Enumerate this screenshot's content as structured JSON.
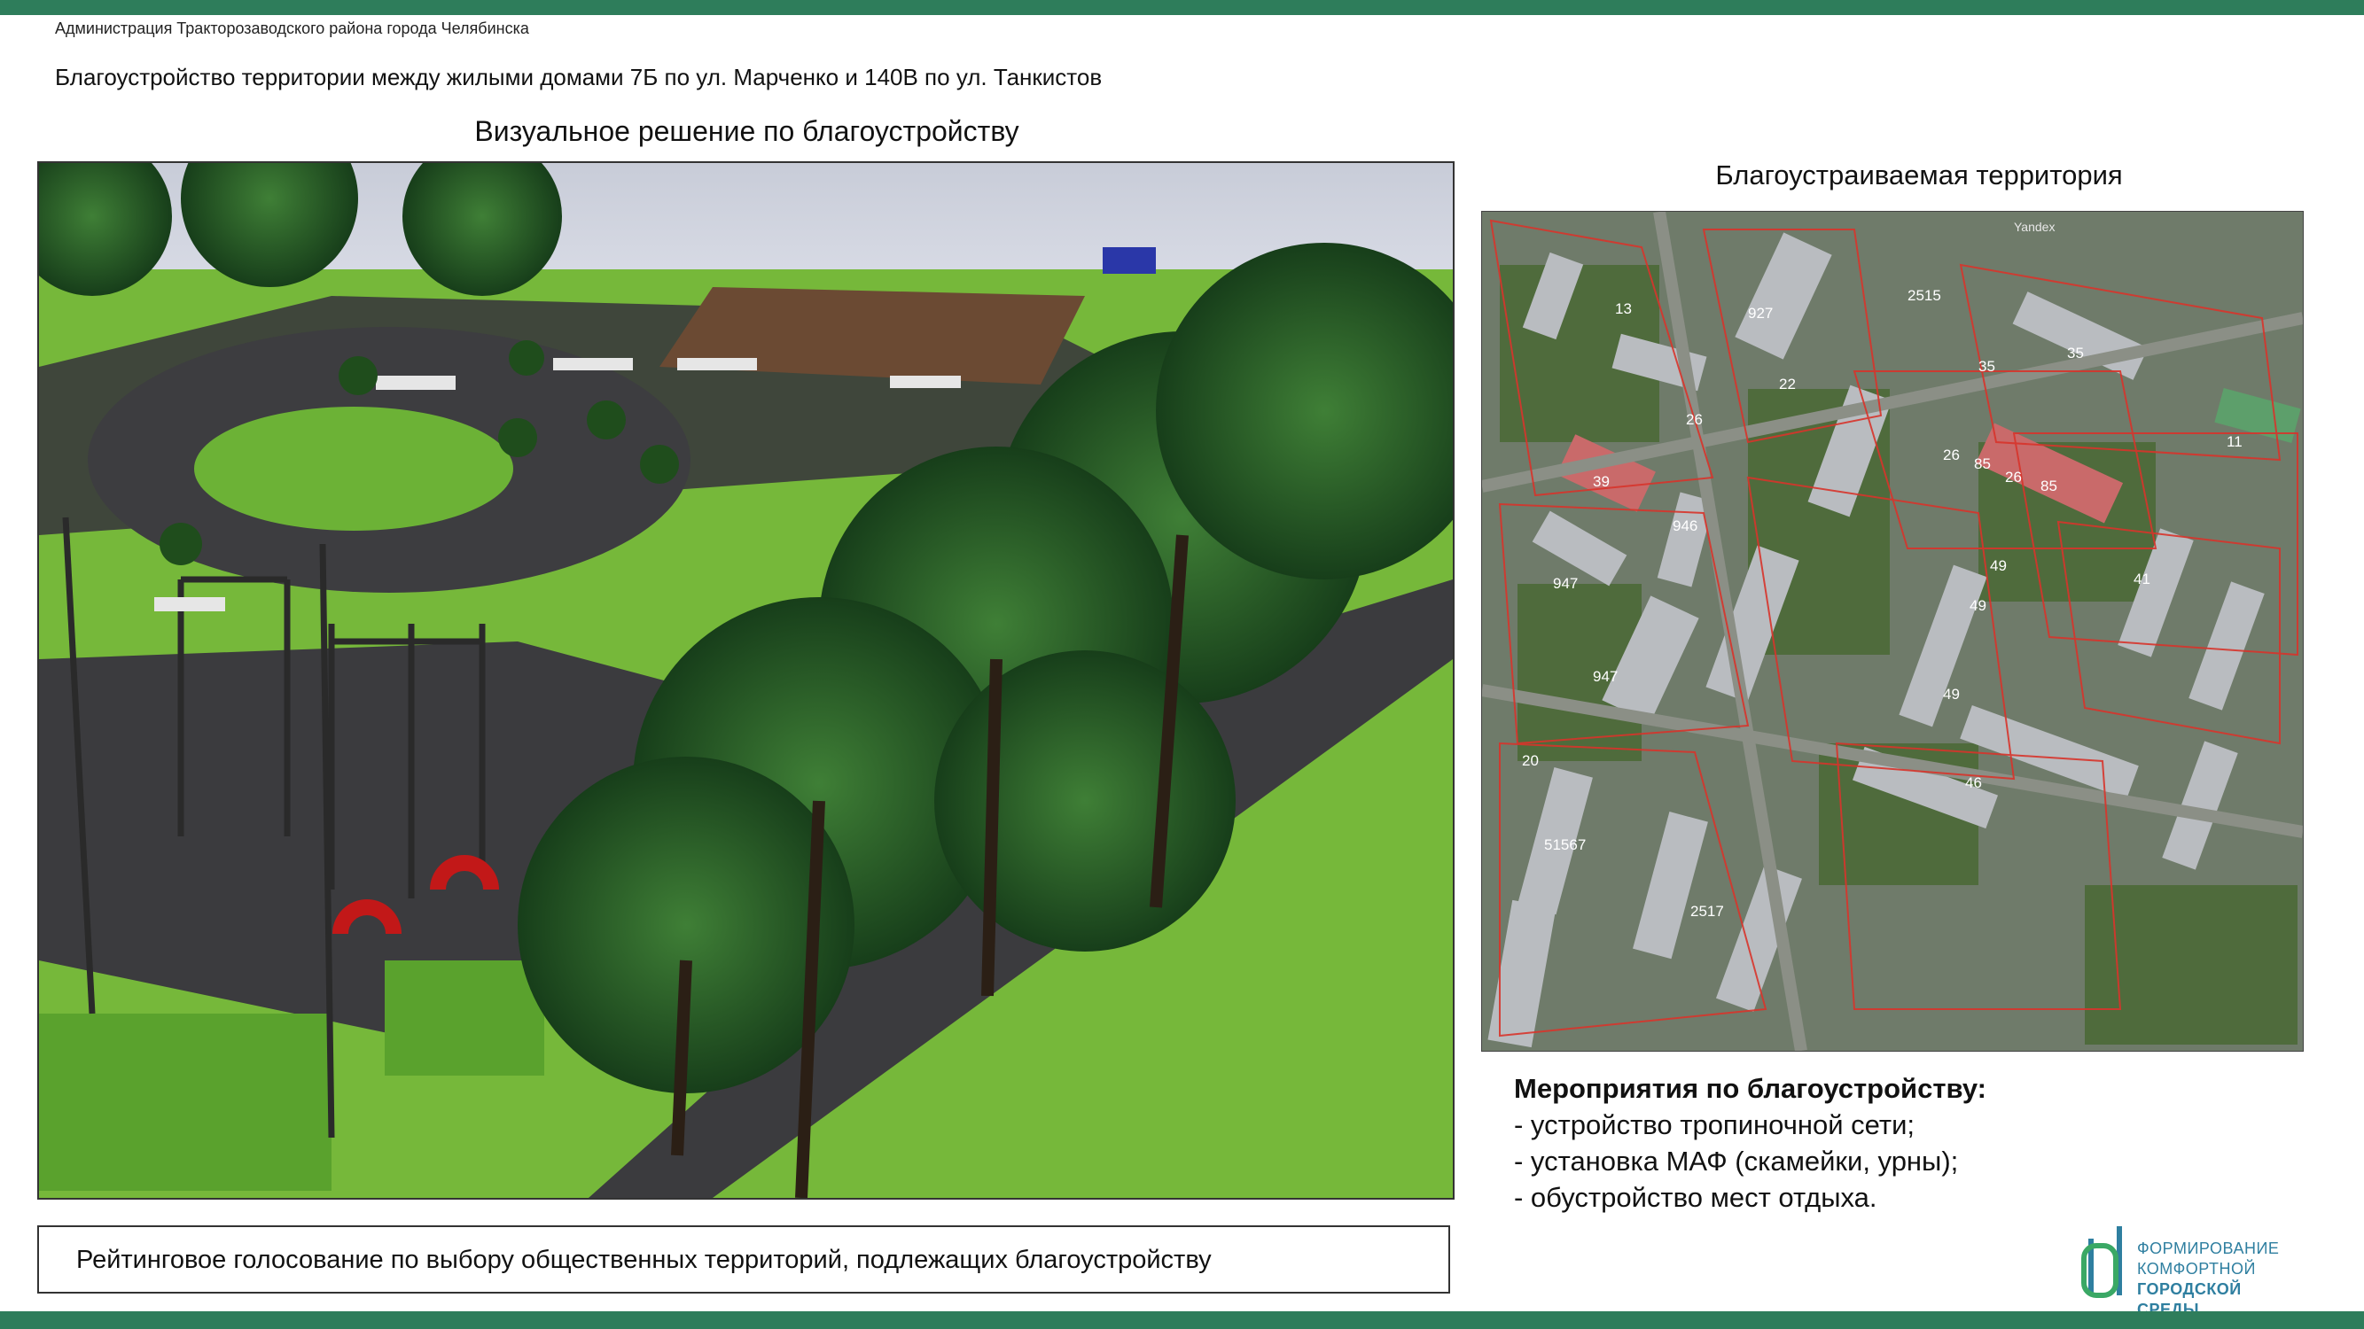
{
  "header": {
    "organization": "Администрация Тракторозаводского района города Челябинска",
    "project_title": "Благоустройство территории между жилыми домами 7Б по ул. Марченко и 140В по ул. Танкистов"
  },
  "render_panel": {
    "caption": "Визуальное решение по благоустройству"
  },
  "map_panel": {
    "caption": "Благоустраиваемая территория",
    "watermark": "Yandex",
    "building_labels": [
      "13",
      "927",
      "2515",
      "22",
      "26",
      "35",
      "35",
      "11",
      "39",
      "946",
      "26",
      "85",
      "26",
      "85",
      "947",
      "947",
      "41",
      "49",
      "49",
      "49",
      "20",
      "51567",
      "2517",
      "46"
    ]
  },
  "measures": {
    "heading": "Мероприятия  по благоустройству:",
    "items": [
      "- устройство тропиночной сети;",
      "- установка МАФ (скамейки, урны);",
      "- обустройство мест отдыха."
    ]
  },
  "voting": {
    "text": "Рейтинговое голосование по выбору общественных территорий, подлежащих благоустройству"
  },
  "logo": {
    "lines": [
      "ФОРМИРОВАНИЕ",
      "КОМФОРТНОЙ",
      "ГОРОДСКОЙ СРЕДЫ"
    ]
  },
  "colors": {
    "brand": "#2e7d5b",
    "logo_text": "#2f7fa0",
    "cadastral_lines": "#d8342b"
  }
}
